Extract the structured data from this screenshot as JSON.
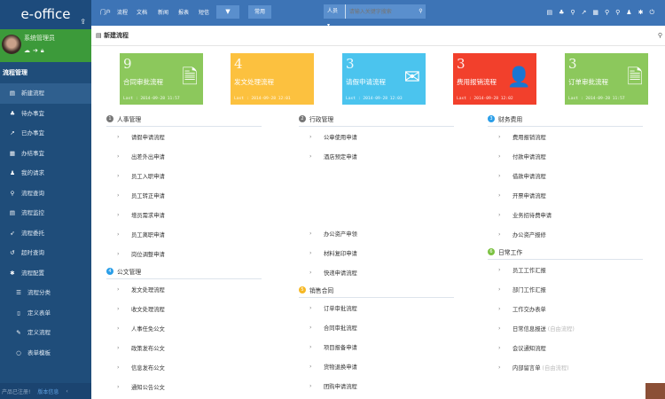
{
  "sidebar": {
    "logo": "e-office",
    "user_name": "系统管理员",
    "section": "流程管理",
    "items": [
      {
        "icon": "new-doc",
        "glyph": "▤",
        "label": "新建流程",
        "active": true
      },
      {
        "icon": "cubes",
        "glyph": "♣",
        "label": "待办事宜"
      },
      {
        "icon": "external-link",
        "glyph": "↗",
        "label": "已办事宜"
      },
      {
        "icon": "calendar",
        "glyph": "▦",
        "label": "办结事宜"
      },
      {
        "icon": "person",
        "glyph": "♟",
        "label": "我的请求"
      },
      {
        "icon": "search",
        "glyph": "⚲",
        "label": "流程查询"
      },
      {
        "icon": "monitor",
        "glyph": "▤",
        "label": "流程监控"
      },
      {
        "icon": "send",
        "glyph": "➶",
        "label": "流程委托"
      },
      {
        "icon": "history",
        "glyph": "↺",
        "label": "超时查询"
      },
      {
        "icon": "gear",
        "glyph": "✱",
        "label": "流程配置"
      },
      {
        "icon": "list",
        "glyph": "☰",
        "label": "流程分类",
        "sub": true
      },
      {
        "icon": "tablet",
        "glyph": "▯",
        "label": "定义表单",
        "sub": true
      },
      {
        "icon": "wrench",
        "glyph": "✎",
        "label": "定义流程",
        "sub": true
      },
      {
        "icon": "refresh",
        "glyph": "○",
        "label": "表单模板",
        "sub": true
      }
    ],
    "footer": {
      "registered": "产品已注册!",
      "version": "版本信息",
      "collapse": "‹"
    }
  },
  "topbar": {
    "nav": [
      "门户",
      "流程",
      "文档",
      "新闻",
      "报表",
      "短信"
    ],
    "more": "▼",
    "common": "常用",
    "search_scope": "人员 ▾",
    "search_placeholder": "请输入关键字搜索",
    "search_btn": "⚲",
    "icons": [
      "▤",
      "♣",
      "⚲",
      "↗",
      "▦",
      "⚲",
      "⚲",
      "♟",
      "✱",
      "⏻"
    ]
  },
  "page": {
    "title": "新建流程"
  },
  "cards": [
    {
      "count": "9",
      "name": "合同审批流程",
      "last": "Last : 2014-09-28 11:57",
      "color": "#8cc85c",
      "icon": "document",
      "glyph": "🗎"
    },
    {
      "count": "4",
      "name": "发文处理流程",
      "last": "Last : 2014-09-28 12:01",
      "color": "#fcc13f",
      "icon": "none",
      "glyph": ""
    },
    {
      "count": "3",
      "name": "请假申请流程",
      "last": "Last : 2014-09-28 12:03",
      "color": "#4bc4ee",
      "icon": "envelope",
      "glyph": "✉"
    },
    {
      "count": "3",
      "name": "费用报销流程",
      "last": "Last : 2014-09-28 12:02",
      "color": "#f2402c",
      "icon": "user",
      "glyph": "👤"
    },
    {
      "count": "3",
      "name": "订单审批流程",
      "last": "Last : 2014-09-28 11:57",
      "color": "#8cc85c",
      "icon": "document",
      "glyph": "🗎"
    }
  ],
  "columns": [
    [
      {
        "title": "人事管理",
        "num": "1",
        "color": "#777",
        "items": [
          "请假申请流程",
          "出差外出申请",
          "员工入职申请",
          "员工转正申请",
          "增员需求申请",
          "员工离职申请",
          "岗位调整申请"
        ]
      },
      {
        "title": "公文管理",
        "num": "4",
        "color": "#2a9ee8",
        "items": [
          "发文处理流程",
          "收文处理流程",
          "人事任免公文",
          "政策发布公文",
          "信息发布公文",
          "通知公告公文"
        ]
      }
    ],
    [
      {
        "title": "行政管理",
        "num": "2",
        "color": "#777",
        "items": [
          "公章使用申请",
          "酒店预定申请"
        ],
        "gap": true,
        "items2": [
          "办公资产申领",
          "材料复印申请",
          "快递申请流程"
        ]
      },
      {
        "title": "销售合同",
        "num": "5",
        "color": "#f6b825",
        "items": [
          "订单审批流程",
          "合同审批流程",
          "项目报备申请",
          "货物退换申请",
          "团购申请流程"
        ]
      }
    ],
    [
      {
        "title": "财务费用",
        "num": "3",
        "color": "#2a9ee8",
        "items": [
          "费用报销流程",
          "付款申请流程",
          "借款申请流程",
          "开票申请流程",
          "业务招待费申请",
          "办公资产报修"
        ]
      },
      {
        "title": "日常工作",
        "num": "6",
        "color": "#7cc242",
        "items": [
          "员工工作汇报",
          "部门工作汇报",
          "工作交办表单",
          {
            "t": "日常信息报送",
            "n": "(自由流程)"
          },
          "会议通知流程",
          {
            "t": "内部留言单",
            "n": "(自由流程)"
          }
        ]
      }
    ]
  ]
}
